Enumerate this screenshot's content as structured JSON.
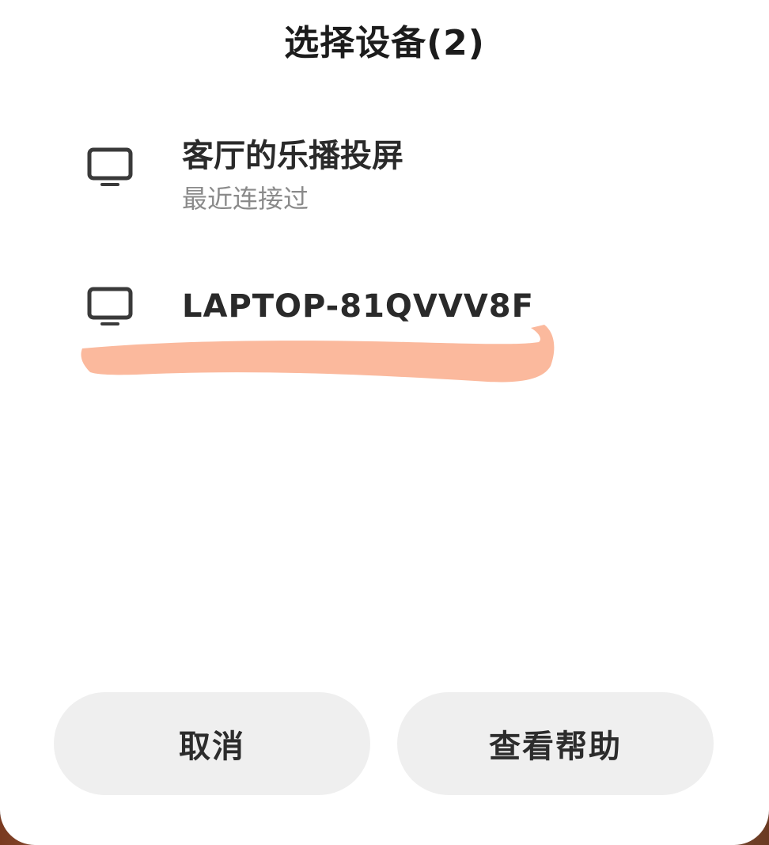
{
  "dialog": {
    "title": "选择设备(2)"
  },
  "devices": [
    {
      "name": "客厅的乐播投屏",
      "subtitle": "最近连接过",
      "icon": "tv-icon"
    },
    {
      "name": "LAPTOP-81QVVV8F",
      "subtitle": "",
      "icon": "tv-icon"
    }
  ],
  "buttons": {
    "cancel_label": "取消",
    "help_label": "查看帮助"
  },
  "colors": {
    "highlight": "#fbb99d",
    "button_bg": "#efefef",
    "text_primary": "#2a2a2a",
    "text_secondary": "#8a8a8a"
  }
}
